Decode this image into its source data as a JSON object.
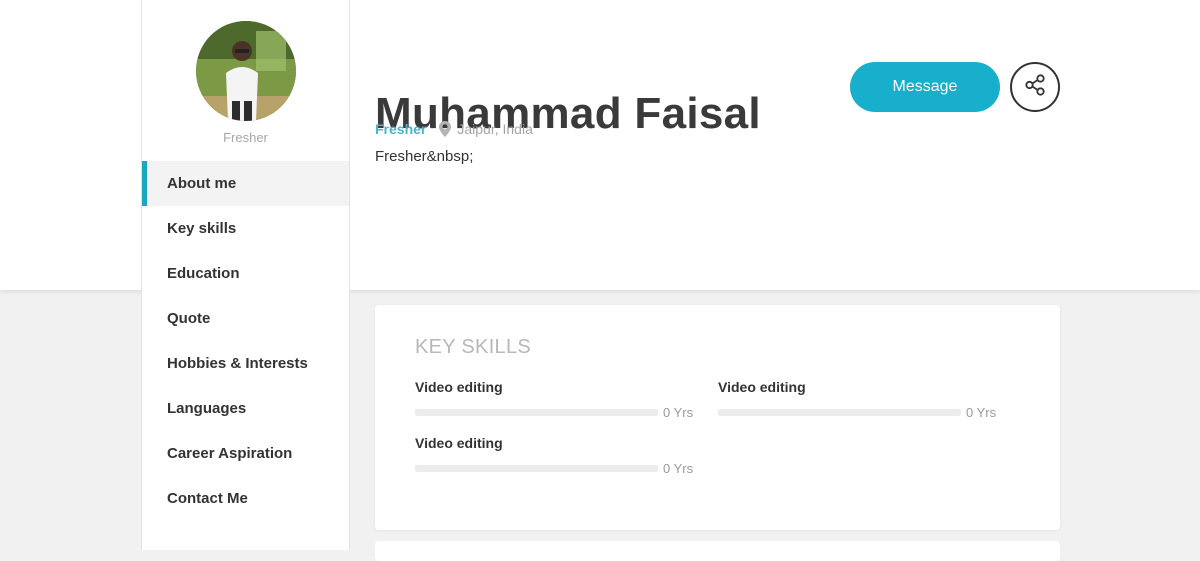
{
  "profile": {
    "name": "Muhammad Faisal",
    "avatar_caption": "Fresher",
    "role": "Fresher",
    "location": "Jaipur, India",
    "summary": "Fresher&nbsp;"
  },
  "actions": {
    "message_label": "Message",
    "share_icon": "share-icon"
  },
  "sidebar": {
    "items": [
      {
        "label": "About me",
        "active": true
      },
      {
        "label": "Key skills",
        "active": false
      },
      {
        "label": "Education",
        "active": false
      },
      {
        "label": "Quote",
        "active": false
      },
      {
        "label": "Hobbies & Interests",
        "active": false
      },
      {
        "label": "Languages",
        "active": false
      },
      {
        "label": "Career Aspiration",
        "active": false
      },
      {
        "label": "Contact Me",
        "active": false
      }
    ]
  },
  "key_skills": {
    "title": "KEY SKILLS",
    "skills": [
      {
        "name": "Video editing",
        "years": "0 Yrs",
        "level": 0
      },
      {
        "name": "Video editing",
        "years": "0 Yrs",
        "level": 0
      },
      {
        "name": "Video editing",
        "years": "0 Yrs",
        "level": 0
      }
    ]
  },
  "colors": {
    "accent": "#17afcc",
    "nav_active_border": "#17a8c4",
    "role_text": "#4ab4cc",
    "muted_text": "#a5a5a5"
  }
}
